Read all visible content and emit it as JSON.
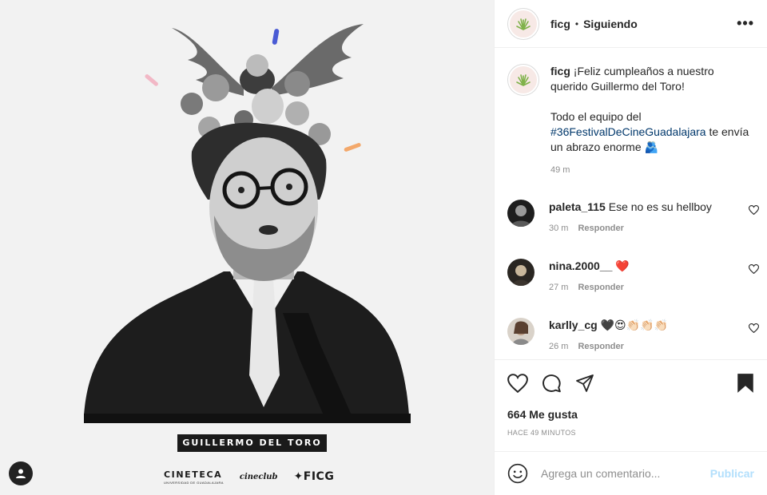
{
  "post": {
    "name_plate": "GUILLERMO DEL TORO",
    "logos": {
      "cineteca": "CINETECA",
      "cineteca_sub": "UNIVERSIDAD DE GUADALAJARA",
      "cineclub": "cineclub",
      "ficg": "FICG"
    },
    "colors": {
      "accent_blue": "#4a5bd4",
      "accent_pink": "#f2b8c6",
      "accent_orange": "#f3a86b"
    }
  },
  "header": {
    "username": "ficg",
    "separator": "•",
    "follow_status": "Siguiendo",
    "more_icon": "more-horizontal-icon"
  },
  "caption": {
    "username": "ficg",
    "text_line1": "¡Feliz cumpleaños a nuestro querido Guillermo del Toro!",
    "text_p2_before": "Todo el equipo del ",
    "hashtag": "#36FestivalDeCineGuadalajara",
    "text_p2_after": " te envía un abrazo enorme 🫂",
    "time": "49 m"
  },
  "comments": [
    {
      "username": "paleta_115",
      "text": "Ese no es su hellboy",
      "time": "30 m",
      "reply": "Responder"
    },
    {
      "username": "nina.2000__",
      "text": "❤️",
      "time": "27 m",
      "reply": "Responder"
    },
    {
      "username": "karlly_cg",
      "text": "🖤😍👏🏻👏🏻👏🏻",
      "time": "26 m",
      "reply": "Responder"
    }
  ],
  "actions": {
    "likes": "664 Me gusta",
    "posted_ago": "HACE 49 MINUTOS"
  },
  "add_comment": {
    "placeholder": "Agrega un comentario...",
    "publish": "Publicar"
  }
}
